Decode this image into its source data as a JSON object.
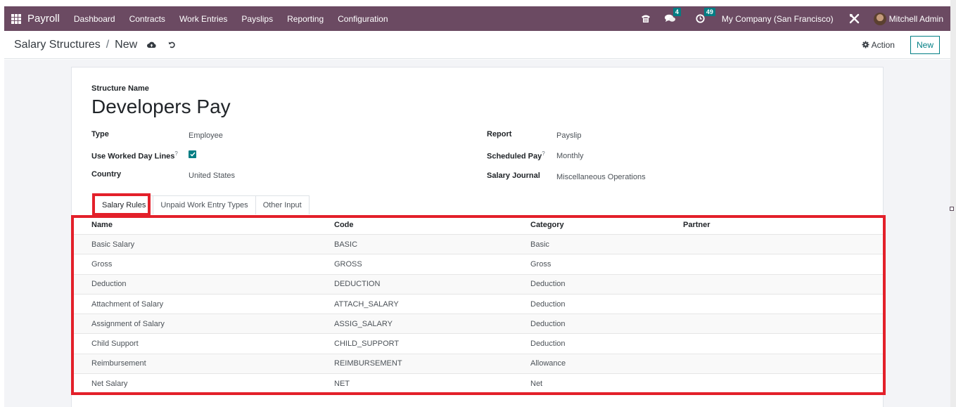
{
  "navbar": {
    "app_name": "Payroll",
    "menu": [
      "Dashboard",
      "Contracts",
      "Work Entries",
      "Payslips",
      "Reporting",
      "Configuration"
    ],
    "icons": [
      "phone-icon",
      "chat-icon",
      "clock-activity-icon",
      "tools-icon"
    ],
    "messages_badge": "4",
    "activities_badge": "49",
    "company": "My Company (San Francisco)",
    "user": "Mitchell Admin",
    "colors": {
      "bar": "#6b4a62",
      "badge": "#017e84"
    }
  },
  "control_panel": {
    "breadcrumb_parent": "Salary Structures",
    "breadcrumb_separator": "/",
    "breadcrumb_current": "New",
    "action_label": "Action",
    "new_label": "New"
  },
  "form": {
    "structure_name_label": "Structure Name",
    "structure_name": "Developers Pay",
    "left_fields": [
      {
        "label": "Type",
        "value": "Employee",
        "help": false
      },
      {
        "label": "Use Worked Day Lines",
        "value": true,
        "help": true
      },
      {
        "label": "Country",
        "value": "United States",
        "help": false
      }
    ],
    "right_fields": [
      {
        "label": "Report",
        "value": "Payslip",
        "help": false
      },
      {
        "label": "Scheduled Pay",
        "value": "Monthly",
        "help": true
      },
      {
        "label": "Salary Journal",
        "value": "Miscellaneous Operations",
        "help": false
      }
    ],
    "help_marker": "?",
    "tabs": [
      "Salary Rules",
      "Unpaid Work Entry Types",
      "Other Input"
    ],
    "active_tab": "Salary Rules"
  },
  "salary_rules": {
    "columns": [
      "Name",
      "Code",
      "Category",
      "Partner"
    ],
    "rows": [
      [
        "Basic Salary",
        "BASIC",
        "Basic",
        ""
      ],
      [
        "Gross",
        "GROSS",
        "Gross",
        ""
      ],
      [
        "Deduction",
        "DEDUCTION",
        "Deduction",
        ""
      ],
      [
        "Attachment of Salary",
        "ATTACH_SALARY",
        "Deduction",
        ""
      ],
      [
        "Assignment of Salary",
        "ASSIG_SALARY",
        "Deduction",
        ""
      ],
      [
        "Child Support",
        "CHILD_SUPPORT",
        "Deduction",
        ""
      ],
      [
        "Reimbursement",
        "REIMBURSEMENT",
        "Allowance",
        ""
      ],
      [
        "Net Salary",
        "NET",
        "Net",
        ""
      ]
    ]
  },
  "annotation": {
    "highlight_color": "#e3202a"
  }
}
